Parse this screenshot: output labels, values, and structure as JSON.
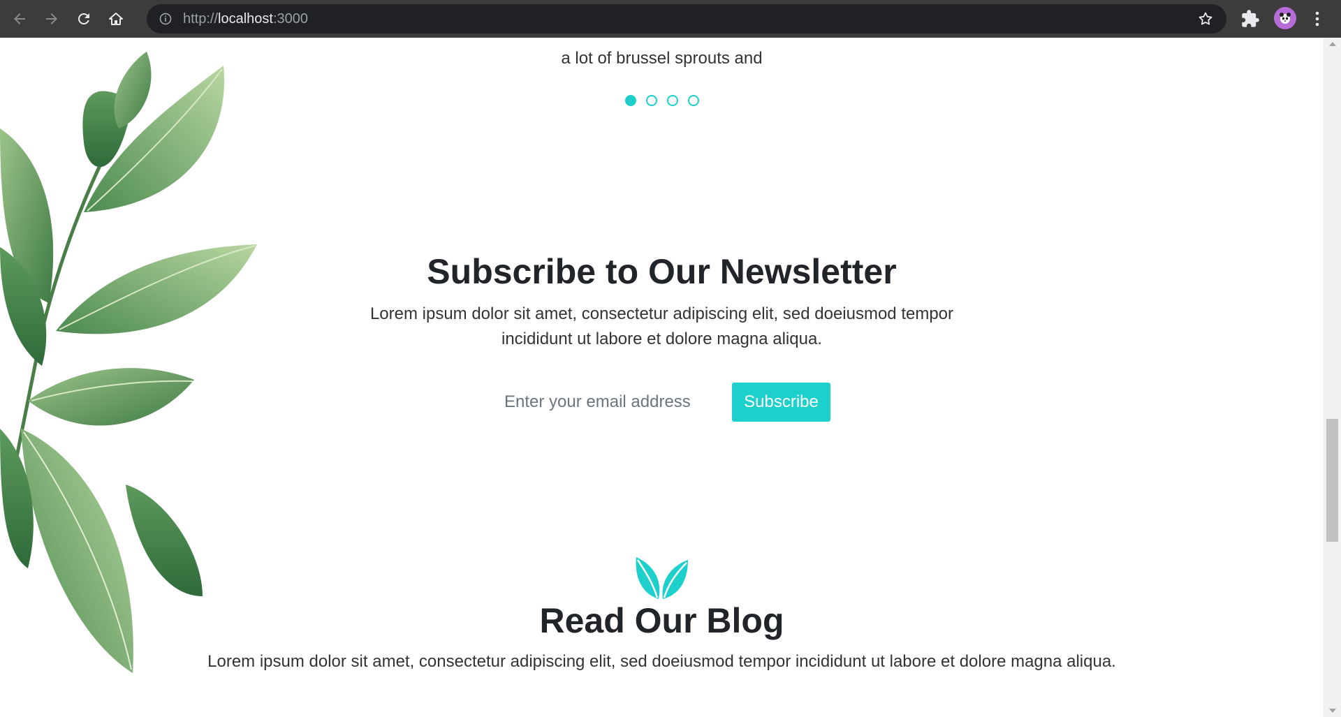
{
  "browser": {
    "url_scheme": "http://",
    "url_host": "localhost",
    "url_port": ":3000"
  },
  "testimonial": {
    "text": "a lot of brussel sprouts and",
    "dots": [
      true,
      false,
      false,
      false
    ]
  },
  "newsletter": {
    "title": "Subscribe to Our Newsletter",
    "description": "Lorem ipsum dolor sit amet, consectetur adipiscing elit, sed doeiusmod tempor incididunt ut labore et dolore magna aliqua.",
    "email_placeholder": "Enter your email address",
    "subscribe_label": "Subscribe"
  },
  "blog": {
    "title": "Read Our Blog",
    "description": "Lorem ipsum dolor sit amet, consectetur adipiscing elit, sed doeiusmod tempor incididunt ut labore et dolore magna aliqua."
  },
  "colors": {
    "accent": "#1ed0cc",
    "chrome_bg": "#3c3c3c",
    "omnibox_bg": "#202124"
  }
}
